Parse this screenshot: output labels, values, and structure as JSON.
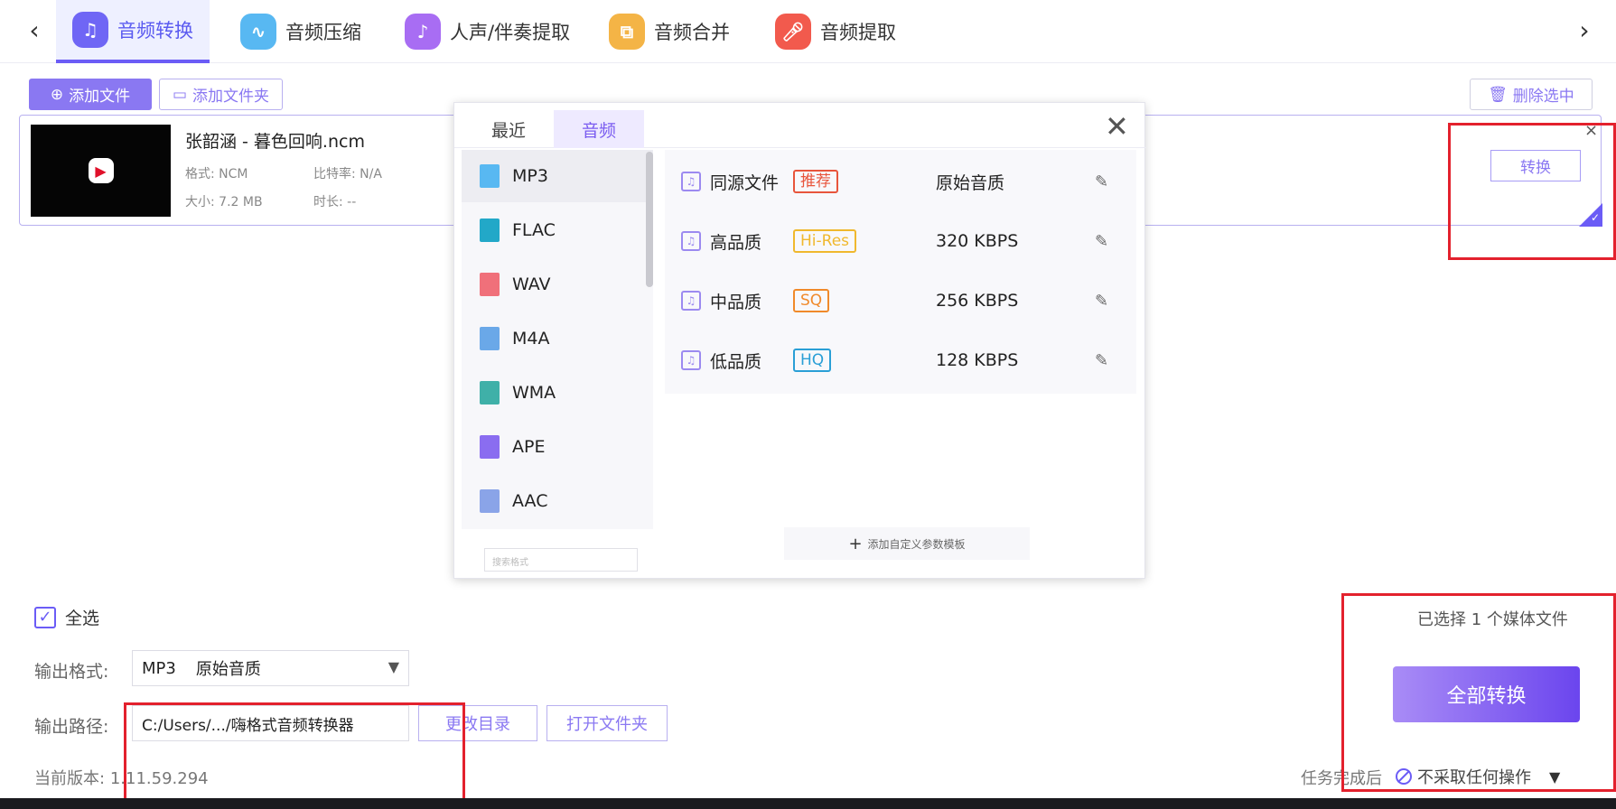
{
  "nav": {
    "back": "‹",
    "forward": "›",
    "tabs": [
      {
        "label": "音频转换",
        "icon": "headphones-icon",
        "color": "#6f66f5"
      },
      {
        "label": "音频压缩",
        "icon": "waveform-icon",
        "color": "#58b8f2"
      },
      {
        "label": "人声/伴奏提取",
        "icon": "voice-icon",
        "color": "#a86df3"
      },
      {
        "label": "音频合并",
        "icon": "merge-icon",
        "color": "#f4b446"
      },
      {
        "label": "音频提取",
        "icon": "microphone-icon",
        "color": "#f25a4d"
      }
    ]
  },
  "toolbar": {
    "add_file": "添加文件",
    "add_folder": "添加文件夹",
    "delete_selected": "删除选中"
  },
  "file": {
    "name": "张韶涵 - 暮色回响.ncm",
    "format_label": "格式:",
    "format_value": "NCM",
    "bitrate_label": "比特率:",
    "bitrate_value": "N/A",
    "size_label": "大小:",
    "size_value": "7.2 MB",
    "duration_label": "时长:",
    "duration_value": "--",
    "convert": "转换",
    "close": "×"
  },
  "popup": {
    "tabs": [
      "最近",
      "音频"
    ],
    "active_tab": "音频",
    "close": "✕",
    "formats": [
      {
        "name": "MP3",
        "color": "#58b8f2",
        "selected": true
      },
      {
        "name": "FLAC",
        "color": "#22a8c8"
      },
      {
        "name": "WAV",
        "color": "#f0707a"
      },
      {
        "name": "M4A",
        "color": "#6aa8e8"
      },
      {
        "name": "WMA",
        "color": "#3fb0a8"
      },
      {
        "name": "APE",
        "color": "#8a6df0"
      },
      {
        "name": "AAC",
        "color": "#8aa4e8"
      }
    ],
    "qualities": [
      {
        "name": "同源文件",
        "badge": "推荐",
        "badge_color": "#e8553c",
        "value": "原始音质"
      },
      {
        "name": "高品质",
        "badge": "Hi-Res",
        "badge_color": "#f0b82e",
        "value": "320 KBPS"
      },
      {
        "name": "中品质",
        "badge": "SQ",
        "badge_color": "#f08a2a",
        "value": "256 KBPS"
      },
      {
        "name": "低品质",
        "badge": "HQ",
        "badge_color": "#2a9fd6",
        "value": "128 KBPS"
      }
    ],
    "add_template": "添加自定义参数模板",
    "search_placeholder": "搜索格式"
  },
  "bottom": {
    "select_all": "全选",
    "output_format_label": "输出格式:",
    "output_format_value": "MP3",
    "output_quality_value": "原始音质",
    "output_path_label": "输出路径:",
    "output_path_value": "C:/Users/.../嗨格式音频转换器",
    "change_dir": "更改目录",
    "open_folder": "打开文件夹",
    "version_label": "当前版本:",
    "version_value": "1.11.59.294",
    "selected_count": "已选择 1 个媒体文件",
    "convert_all": "全部转换",
    "after_task_label": "任务完成后",
    "after_task_value": "不采取任何操作"
  }
}
